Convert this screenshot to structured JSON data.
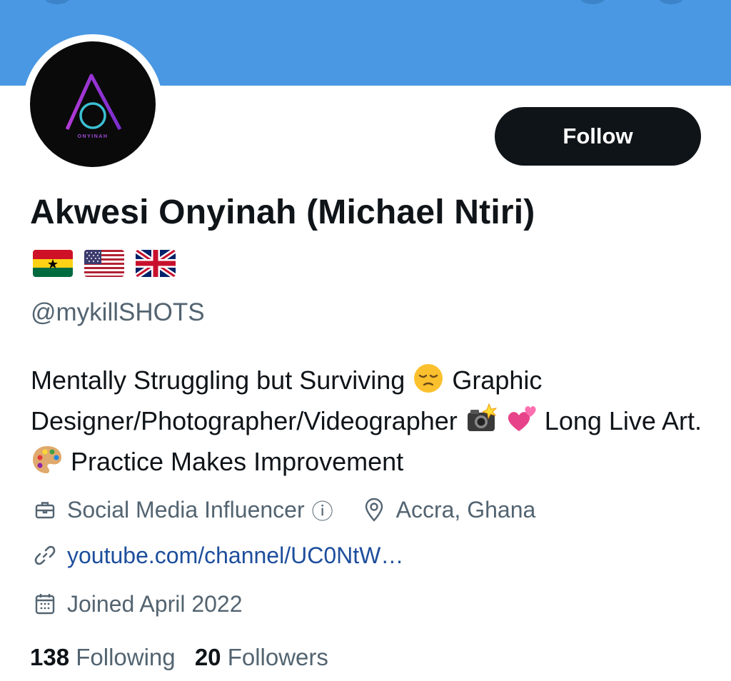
{
  "profile": {
    "avatar_wordmark": "ONYINAH",
    "follow_label": "Follow",
    "display_name": "Akwesi Onyinah (Michael Ntiri)",
    "flags": [
      "Ghana",
      "United States",
      "United Kingdom"
    ],
    "handle": "@mykillSHOTS",
    "bio": {
      "part1": "Mentally Struggling but Surviving",
      "part2": "Graphic Designer/Photographer/Videographer",
      "part3": "Long Live Art.",
      "part4": "Practice Makes Improvement"
    },
    "category": "Social Media Influencer",
    "category_info": "ⓘ",
    "location": "Accra, Ghana",
    "link": "youtube.com/channel/UC0NtW…",
    "joined": "Joined April 2022",
    "following_count": "138",
    "following_label": "Following",
    "followers_count": "20",
    "followers_label": "Followers"
  },
  "icons": {
    "category": "briefcase-icon",
    "location": "location-pin-icon",
    "link": "link-icon",
    "joined": "calendar-icon",
    "bio_emoji": [
      "pensive-face-emoji",
      "camera-flash-emoji",
      "two-hearts-emoji",
      "artist-palette-emoji"
    ]
  },
  "colors": {
    "banner": "#4a98e3",
    "follow_button": "#0f1419",
    "secondary_text": "#536471",
    "link": "#1d4e9c"
  }
}
